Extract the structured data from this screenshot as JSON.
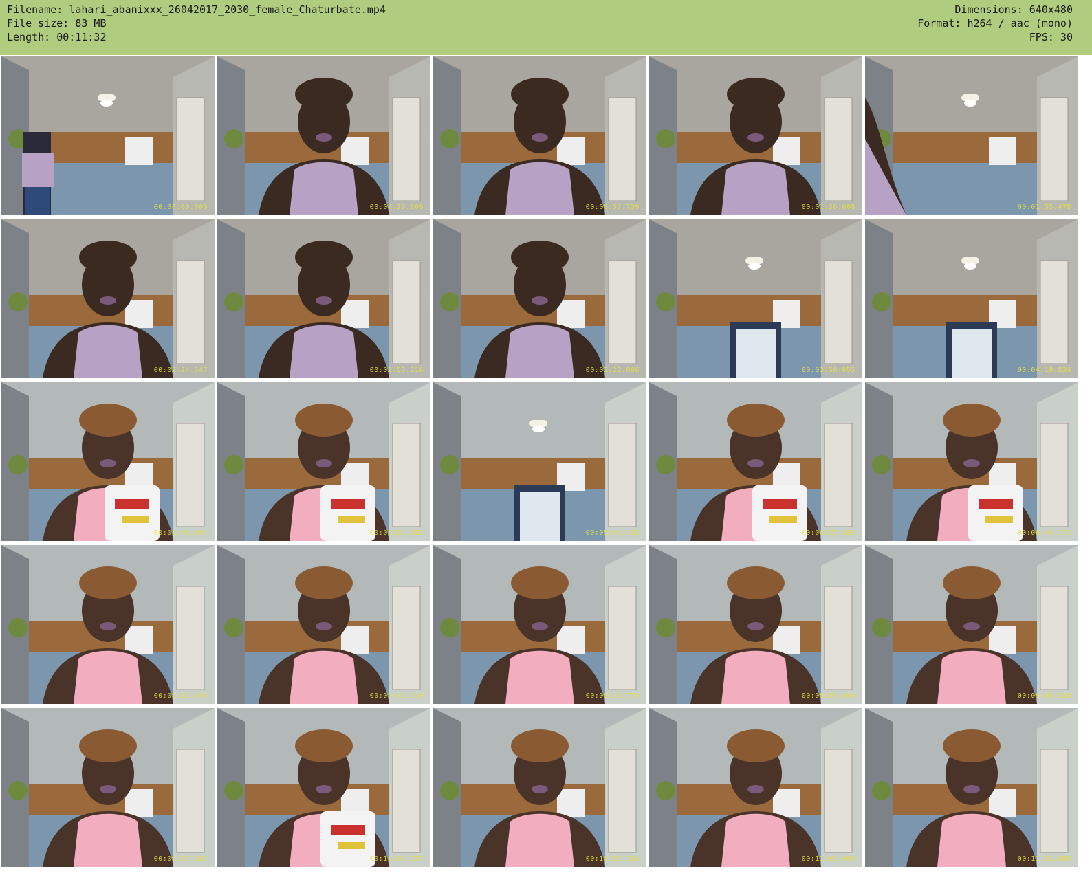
{
  "header": {
    "filename_line": "Filename: lahari_abanixxx_26042017_2030_female_Chaturbate.mp4",
    "filesize_line": "File size: 83 MB",
    "length_line": "Length: 00:11:32",
    "dimensions_line": "Dimensions: 640x480",
    "format_line": "Format: h264 / aac (mono)",
    "fps_line": "FPS: 30"
  },
  "colors": {
    "header_bg": "#b0cc7e",
    "timestamp": "#e6e23a",
    "shirt_purple": "#b7a2c6",
    "shirt_pink": "#f2adbe"
  },
  "thumbnails": [
    {
      "timestamp": "00:00:00.000",
      "scene": "room-empty-standing"
    },
    {
      "timestamp": "00:00:28.869",
      "scene": "purple-eating"
    },
    {
      "timestamp": "00:00:57.739",
      "scene": "purple-eating"
    },
    {
      "timestamp": "00:01:26.608",
      "scene": "purple-eating"
    },
    {
      "timestamp": "00:01:55.478",
      "scene": "purple-partial"
    },
    {
      "timestamp": "00:02:24.347",
      "scene": "purple-close"
    },
    {
      "timestamp": "00:02:53.216",
      "scene": "purple-seated"
    },
    {
      "timestamp": "00:03:22.086",
      "scene": "purple-seated"
    },
    {
      "timestamp": "00:03:50.955",
      "scene": "room-mirror"
    },
    {
      "timestamp": "00:04:19.824",
      "scene": "room-mirror"
    },
    {
      "timestamp": "00:04:48.694",
      "scene": "pink-bag"
    },
    {
      "timestamp": "00:05:17.563",
      "scene": "pink-bag"
    },
    {
      "timestamp": "00:05:46.432",
      "scene": "room-bright"
    },
    {
      "timestamp": "00:06:15.302",
      "scene": "pink-bag"
    },
    {
      "timestamp": "00:06:44.171",
      "scene": "pink-bag"
    },
    {
      "timestamp": "00:07:13.040",
      "scene": "pink-seated"
    },
    {
      "timestamp": "00:07:41.910",
      "scene": "pink-seated"
    },
    {
      "timestamp": "00:08:10.779",
      "scene": "pink-seated"
    },
    {
      "timestamp": "00:08:39.648",
      "scene": "pink-seated"
    },
    {
      "timestamp": "00:09:08.518",
      "scene": "pink-seated"
    },
    {
      "timestamp": "00:09:37.387",
      "scene": "pink-seated"
    },
    {
      "timestamp": "00:10:06.257",
      "scene": "pink-bag"
    },
    {
      "timestamp": "00:10:35.126",
      "scene": "pink-seated"
    },
    {
      "timestamp": "00:11:03.995",
      "scene": "pink-seated"
    },
    {
      "timestamp": "00:11:32.865",
      "scene": "pink-seated"
    }
  ]
}
